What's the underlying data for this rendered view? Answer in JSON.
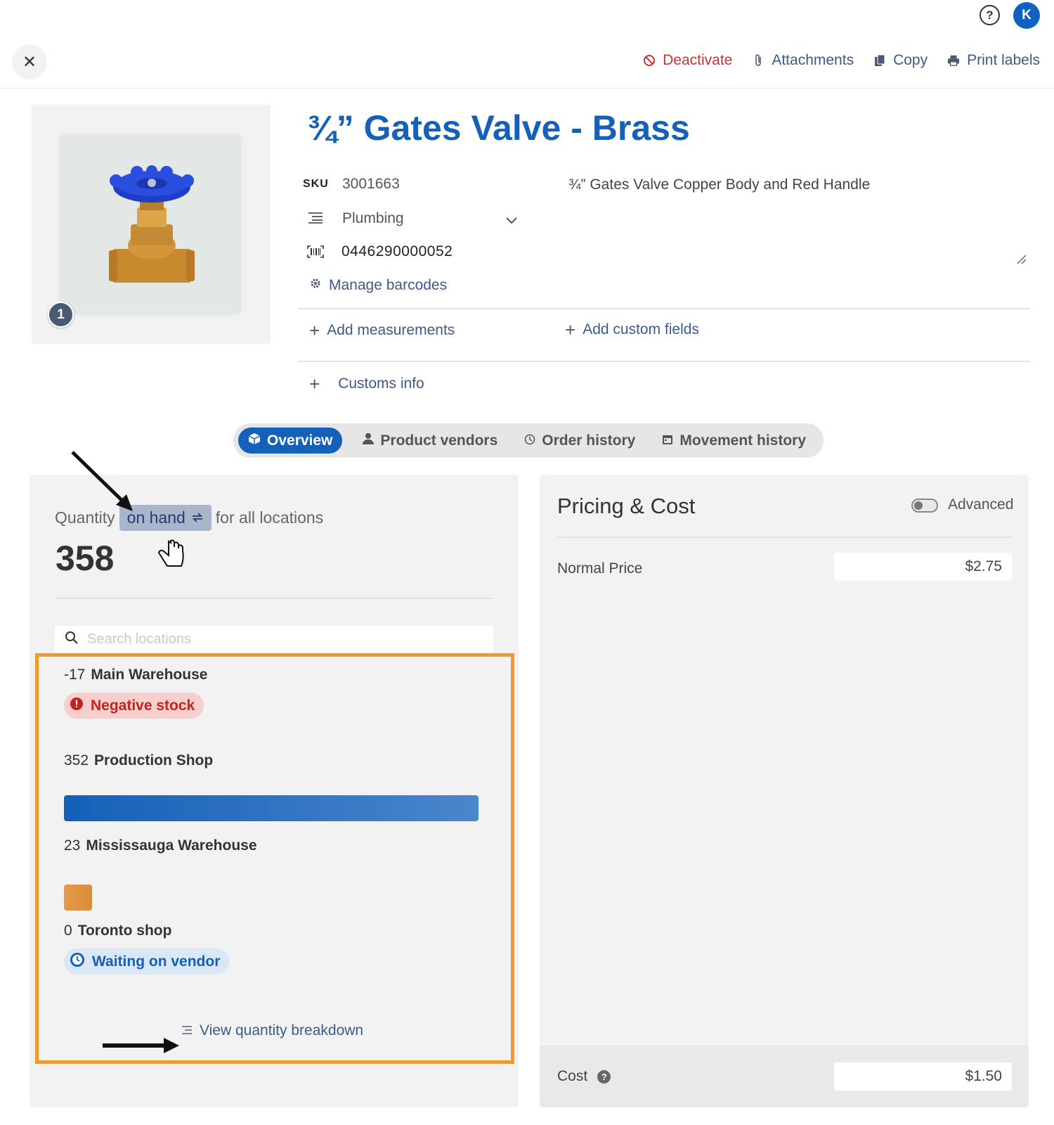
{
  "header": {
    "user_initial": "K",
    "actions": [
      {
        "label": "Deactivate",
        "icon": "ban-icon"
      },
      {
        "label": "Attachments",
        "icon": "paperclip-icon"
      },
      {
        "label": "Copy",
        "icon": "copy-icon"
      },
      {
        "label": "Print labels",
        "icon": "printer-icon"
      }
    ]
  },
  "product": {
    "image_count": "1",
    "title": "¾” Gates Valve - Brass",
    "sku_label": "SKU",
    "sku": "3001663",
    "description": "¾” Gates Valve Copper Body and Red Handle",
    "category": "Plumbing",
    "barcode": "0446290000052",
    "manage_barcodes": "Manage barcodes",
    "add_measurements": "Add measurements",
    "add_custom_fields": "Add custom fields",
    "customs_info": "Customs info"
  },
  "tabs": [
    {
      "label": "Overview",
      "icon": "box-icon",
      "active": true
    },
    {
      "label": "Product vendors",
      "icon": "person-icon"
    },
    {
      "label": "Order history",
      "icon": "clock-icon"
    },
    {
      "label": "Movement history",
      "icon": "calendar-icon"
    }
  ],
  "quantity": {
    "prefix": "Quantity",
    "mode": "on hand",
    "suffix": "for all locations",
    "total": "358",
    "search_placeholder": "Search locations",
    "locations": [
      {
        "qty": "-17",
        "name": "Main Warehouse",
        "badge": "Negative stock"
      },
      {
        "qty": "352",
        "name": "Production Shop",
        "bar_fraction": 0.983
      },
      {
        "qty": "23",
        "name": "Mississauga Warehouse",
        "bar_fraction": 0.064
      },
      {
        "qty": "0",
        "name": "Toronto shop",
        "badge": "Waiting on vendor"
      }
    ],
    "view_breakdown": "View quantity breakdown"
  },
  "pricing": {
    "title": "Pricing & Cost",
    "advanced_label": "Advanced",
    "advanced_on": false,
    "normal_price_label": "Normal Price",
    "normal_price": "$2.75",
    "cost_label": "Cost",
    "cost": "$1.50"
  },
  "colors": {
    "brand_blue": "#1560b8",
    "danger_red": "#d0312d",
    "highlight_orange": "#ee9a2e"
  }
}
